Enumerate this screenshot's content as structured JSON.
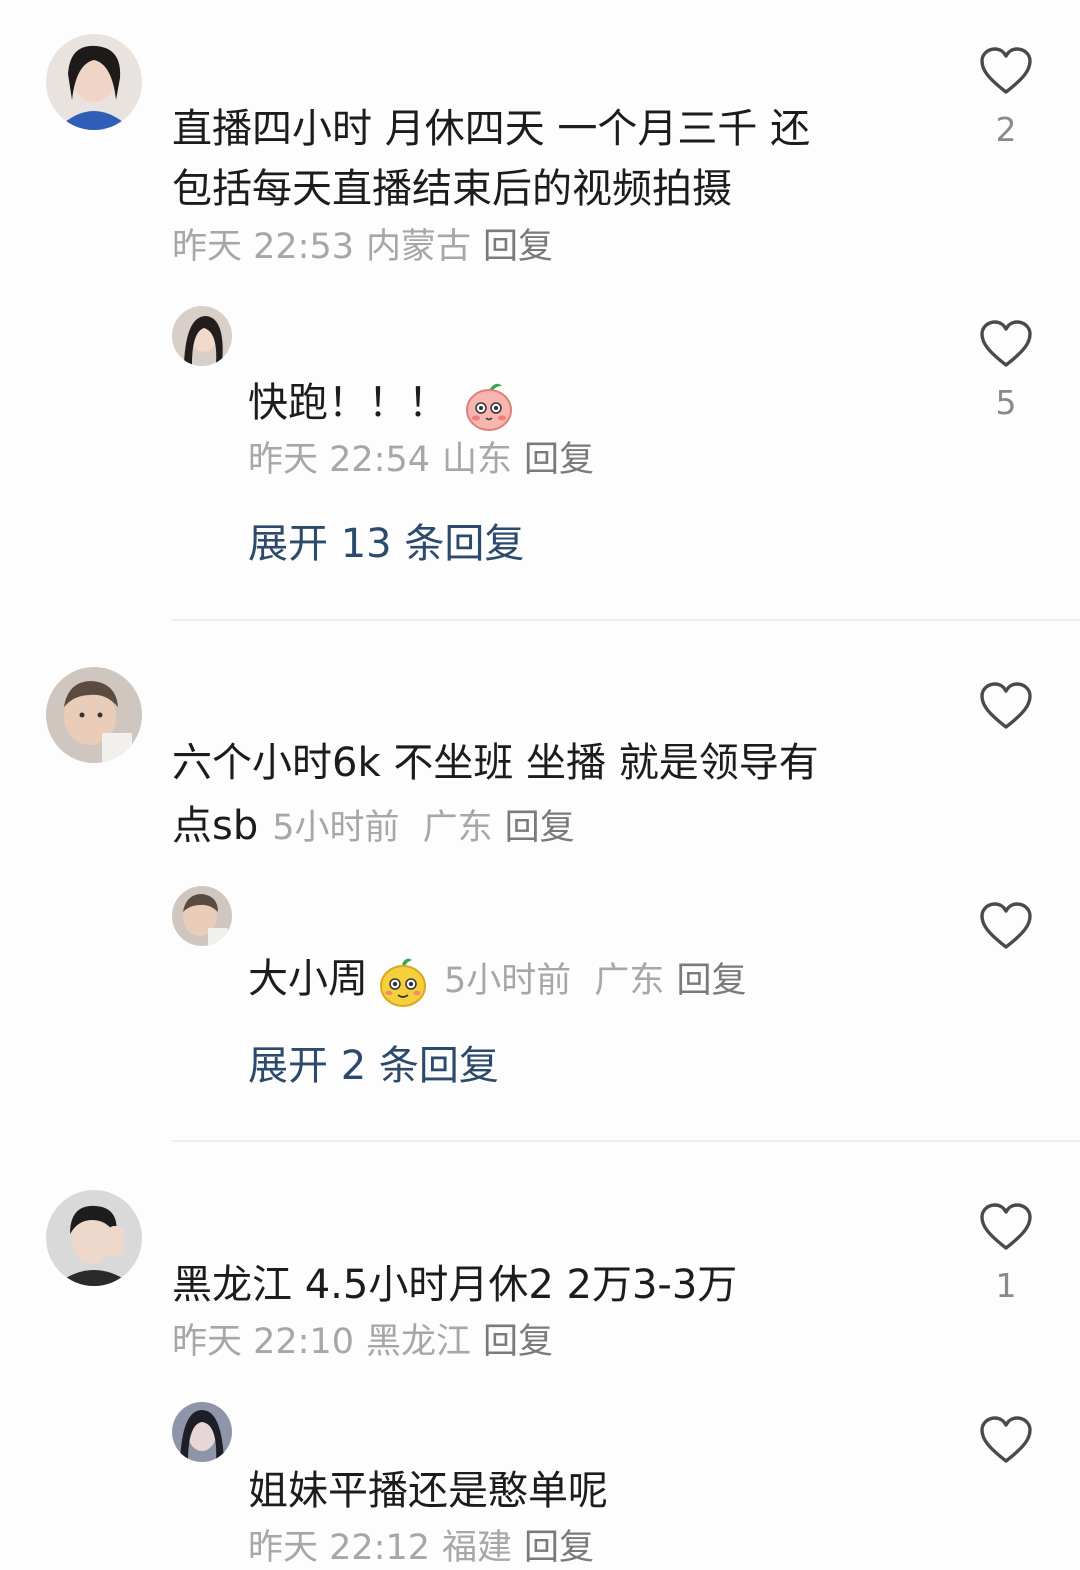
{
  "comments": [
    {
      "text_line1": "直播四小时  月休四天  一个月三千  还",
      "text_line2": "包括每天直播结束后的视频拍摄",
      "time": "昨天 22:53",
      "location": "内蒙古",
      "reply_label": "回复",
      "likes": "2",
      "reply": {
        "text": "快跑！！！",
        "emoji": "blushing-peach-emoji",
        "time": "昨天 22:54",
        "location": "山东",
        "reply_label": "回复",
        "likes": "5"
      },
      "expand_label": "展开 13 条回复"
    },
    {
      "text_line1": "六个小时6k 不坐班 坐播 就是领导有",
      "text_line2": "点sb",
      "time": "5小时前",
      "location": "广东",
      "reply_label": "回复",
      "likes": "",
      "reply": {
        "text": "大小周",
        "emoji": "yellow-fruit-emoji",
        "time": "5小时前",
        "location": "广东",
        "reply_label": "回复",
        "likes": ""
      },
      "expand_label": "展开 2 条回复"
    },
    {
      "text_line1": "黑龙江 4.5小时月休2   2万3-3万",
      "time": "昨天 22:10",
      "location": "黑龙江",
      "reply_label": "回复",
      "likes": "1",
      "reply": {
        "text": "姐妹平播还是憨单呢",
        "time": "昨天 22:12",
        "location": "福建",
        "reply_label": "回复",
        "likes": ""
      }
    }
  ],
  "colors": {
    "expand_link": "#2c4a6b",
    "meta_text": "#a7a7a7",
    "main_text": "#1c1c1c",
    "heart_outline": "#4a4a4a"
  }
}
